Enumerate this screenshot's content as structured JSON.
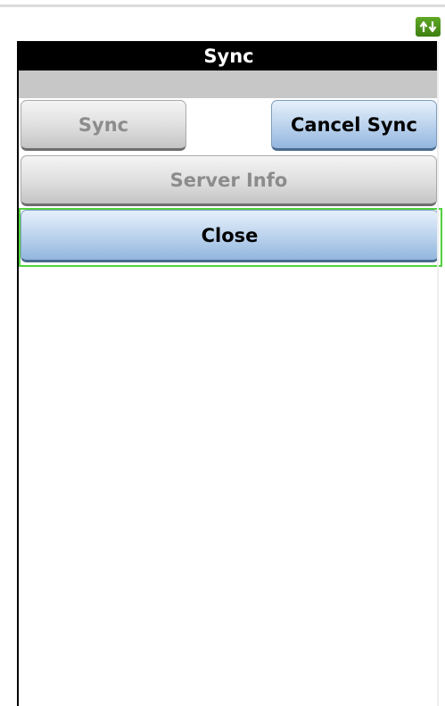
{
  "header": {
    "sync_indicator_icon": "sync-arrows-icon",
    "sync_indicator_color": "#4e9a1d"
  },
  "dialog": {
    "title": "Sync",
    "buttons": {
      "sync": {
        "label": "Sync",
        "enabled": false
      },
      "cancel_sync": {
        "label": "Cancel Sync",
        "enabled": true
      },
      "server_info": {
        "label": "Server Info",
        "enabled": false
      },
      "close": {
        "label": "Close",
        "enabled": true,
        "focused": true
      }
    },
    "focus_color": "#52d13f",
    "primary_button_color": "#b9d1ec",
    "disabled_button_color": "#dedede"
  }
}
